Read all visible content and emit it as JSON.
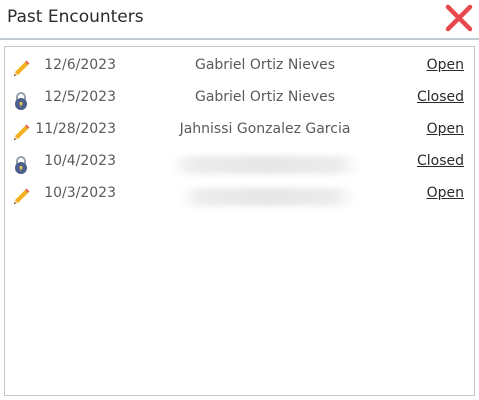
{
  "dialog": {
    "title": "Past Encounters",
    "close_icon": "close-icon",
    "close_color": "#e8484d"
  },
  "encounters": [
    {
      "icon": "pencil-icon",
      "date": "12/6/2023",
      "provider": "Gabriel Ortiz Nieves",
      "status": "Open"
    },
    {
      "icon": "lock-icon",
      "date": "12/5/2023",
      "provider": "Gabriel Ortiz Nieves",
      "status": "Closed"
    },
    {
      "icon": "pencil-icon",
      "date": "11/28/2023",
      "provider": "Jahnissi Gonzalez Garcia",
      "status": "Open"
    },
    {
      "icon": "lock-icon",
      "date": "10/4/2023",
      "provider": "",
      "status": "Closed"
    },
    {
      "icon": "pencil-icon",
      "date": "10/3/2023",
      "provider": "",
      "status": "Open"
    }
  ]
}
